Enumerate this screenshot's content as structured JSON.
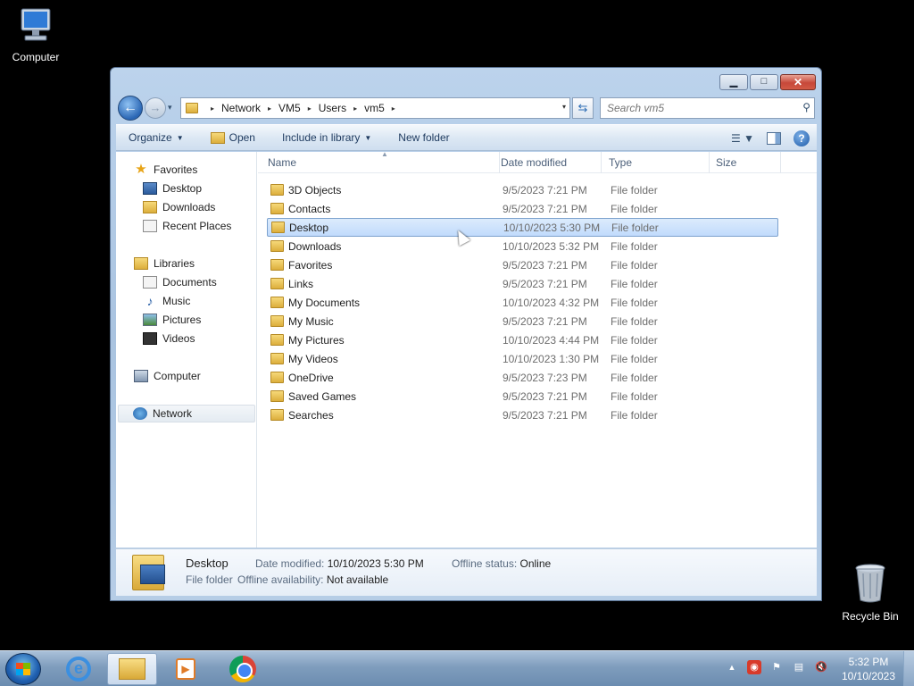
{
  "desktop": {
    "icons": [
      {
        "label": "Computer"
      },
      {
        "label": "Recycle Bin"
      }
    ]
  },
  "window": {
    "controls": {
      "minimize": "▁",
      "maximize": "□",
      "close": "✕"
    },
    "nav": {
      "back": "←",
      "forward": "→",
      "history": "▾",
      "breadcrumb": [
        "Network",
        "VM5",
        "Users",
        "vm5"
      ],
      "breadcrumb_sep": "▸",
      "refresh": "⇆",
      "search_placeholder": "Search vm5"
    },
    "toolbar": {
      "organize": "Organize",
      "open": "Open",
      "include": "Include in library",
      "new_folder": "New folder"
    },
    "sidebar": {
      "favorites": {
        "label": "Favorites",
        "items": [
          "Desktop",
          "Downloads",
          "Recent Places"
        ]
      },
      "libraries": {
        "label": "Libraries",
        "items": [
          "Documents",
          "Music",
          "Pictures",
          "Videos"
        ]
      },
      "computer": "Computer",
      "network": "Network"
    },
    "columns": {
      "name": "Name",
      "date": "Date modified",
      "type": "Type",
      "size": "Size"
    },
    "files": [
      {
        "name": "3D Objects",
        "date": "9/5/2023 7:21 PM",
        "type": "File folder"
      },
      {
        "name": "Contacts",
        "date": "9/5/2023 7:21 PM",
        "type": "File folder"
      },
      {
        "name": "Desktop",
        "date": "10/10/2023 5:30 PM",
        "type": "File folder",
        "selected": true
      },
      {
        "name": "Downloads",
        "date": "10/10/2023 5:32 PM",
        "type": "File folder"
      },
      {
        "name": "Favorites",
        "date": "9/5/2023 7:21 PM",
        "type": "File folder"
      },
      {
        "name": "Links",
        "date": "9/5/2023 7:21 PM",
        "type": "File folder"
      },
      {
        "name": "My Documents",
        "date": "10/10/2023 4:32 PM",
        "type": "File folder"
      },
      {
        "name": "My Music",
        "date": "9/5/2023 7:21 PM",
        "type": "File folder"
      },
      {
        "name": "My Pictures",
        "date": "10/10/2023 4:44 PM",
        "type": "File folder"
      },
      {
        "name": "My Videos",
        "date": "10/10/2023 1:30 PM",
        "type": "File folder"
      },
      {
        "name": "OneDrive",
        "date": "9/5/2023 7:23 PM",
        "type": "File folder"
      },
      {
        "name": "Saved Games",
        "date": "9/5/2023 7:21 PM",
        "type": "File folder"
      },
      {
        "name": "Searches",
        "date": "9/5/2023 7:21 PM",
        "type": "File folder"
      }
    ],
    "details": {
      "name": "Desktop",
      "type": "File folder",
      "date_label": "Date modified:",
      "date_value": "10/10/2023 5:30 PM",
      "offline_status_label": "Offline status:",
      "offline_status_value": "Online",
      "offline_avail_label": "Offline availability:",
      "offline_avail_value": "Not available"
    }
  },
  "taskbar": {
    "tray_up": "▲",
    "clock_time": "5:32 PM",
    "clock_date": "10/10/2023"
  }
}
